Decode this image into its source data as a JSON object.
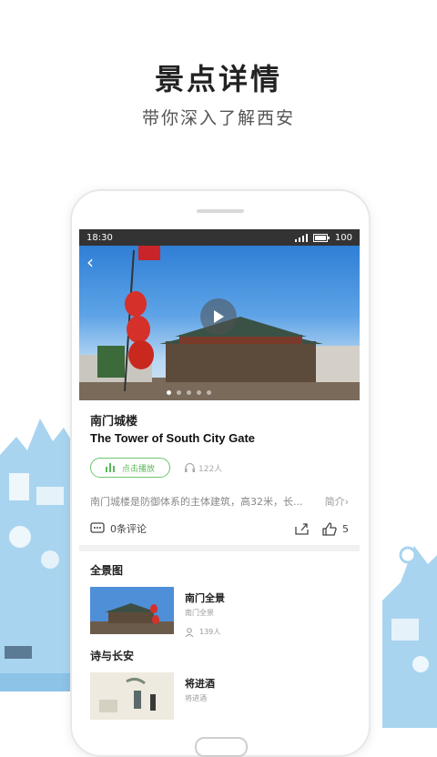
{
  "promo": {
    "title": "景点详情",
    "subtitle": "带你深入了解西安"
  },
  "status": {
    "time": "18:30",
    "battery": "100"
  },
  "spot": {
    "name_cn": "南门城楼",
    "name_en": "The Tower of South City Gate",
    "play_label": "点击播放",
    "listen_count": "122人",
    "description": "南门城楼是防御体系的主体建筑，高32米，长...",
    "more_label": "简介",
    "comment_label": "0条评论",
    "like_count": "5"
  },
  "sections": [
    {
      "title": "全景图",
      "item": {
        "title": "南门全景",
        "subtitle": "南门全景",
        "count": "139人"
      }
    },
    {
      "title": "诗与长安",
      "item": {
        "title": "将进酒",
        "subtitle": "将进酒"
      }
    }
  ],
  "colors": {
    "accent_green": "#5cb85c",
    "sky_blue": "#2f7fd6",
    "deco_blue": "#a9d4ef"
  }
}
